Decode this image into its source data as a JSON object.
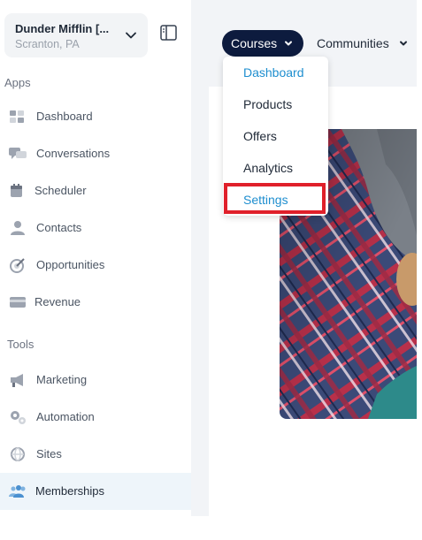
{
  "account": {
    "name": "Dunder Mifflin [...",
    "location": "Scranton, PA"
  },
  "sidebar": {
    "apps_label": "Apps",
    "tools_label": "Tools",
    "apps": [
      {
        "label": "Dashboard",
        "icon": "dashboard-icon"
      },
      {
        "label": "Conversations",
        "icon": "chat-icon"
      },
      {
        "label": "Scheduler",
        "icon": "calendar-icon"
      },
      {
        "label": "Contacts",
        "icon": "person-icon"
      },
      {
        "label": "Opportunities",
        "icon": "target-icon"
      },
      {
        "label": "Revenue",
        "icon": "card-icon"
      }
    ],
    "tools": [
      {
        "label": "Marketing",
        "icon": "megaphone-icon"
      },
      {
        "label": "Automation",
        "icon": "gears-icon"
      },
      {
        "label": "Sites",
        "icon": "globe-icon"
      },
      {
        "label": "Memberships",
        "icon": "group-icon",
        "active": true
      }
    ]
  },
  "topnav": {
    "tabs": [
      {
        "label": "Courses",
        "active": true
      },
      {
        "label": "Communities",
        "active": false
      }
    ]
  },
  "dropdown": {
    "items": [
      {
        "label": "Dashboard",
        "color": "#1e8ecf"
      },
      {
        "label": "Products"
      },
      {
        "label": "Offers"
      },
      {
        "label": "Analytics"
      },
      {
        "label": "Settings",
        "color": "#1e8ecf",
        "highlighted": true
      }
    ]
  },
  "colors": {
    "accent": "#1e8ecf",
    "nav_active_bg": "#0d1b3e",
    "highlight": "#e0202a"
  }
}
